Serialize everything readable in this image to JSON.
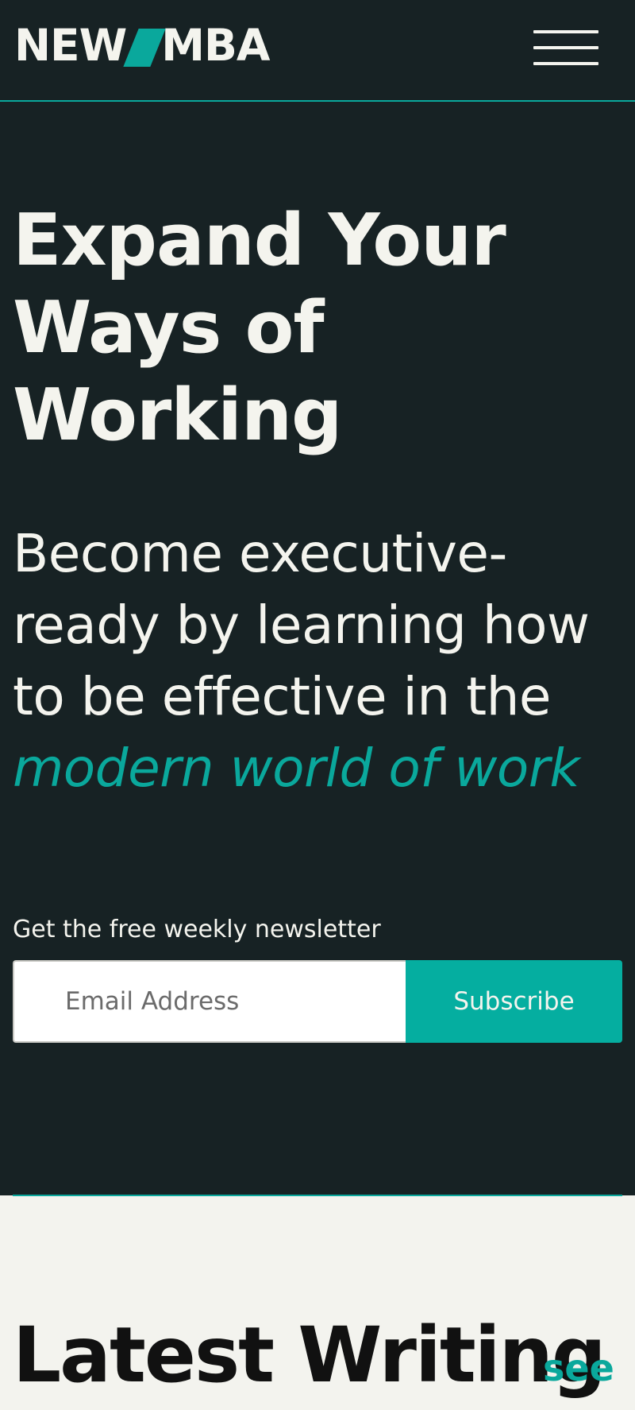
{
  "header": {
    "logo_left": "NEW",
    "logo_right": "MBA",
    "menu_icon": "hamburger-menu-icon"
  },
  "hero": {
    "title": "Expand Your Ways of Working",
    "subtitle_plain": "Become executive-ready by learning how to be effective in the ",
    "subtitle_accent": "modern world of work"
  },
  "newsletter": {
    "label": "Get the free weekly newsletter",
    "email_placeholder": "Email Address",
    "email_value": "",
    "subscribe_label": "Subscribe"
  },
  "latest": {
    "title": "Latest Writing",
    "see_link": "see"
  },
  "colors": {
    "background_dark": "#172224",
    "accent": "#0aa89c",
    "text_light": "#f4f4ee",
    "background_light": "#f3f3ee"
  }
}
